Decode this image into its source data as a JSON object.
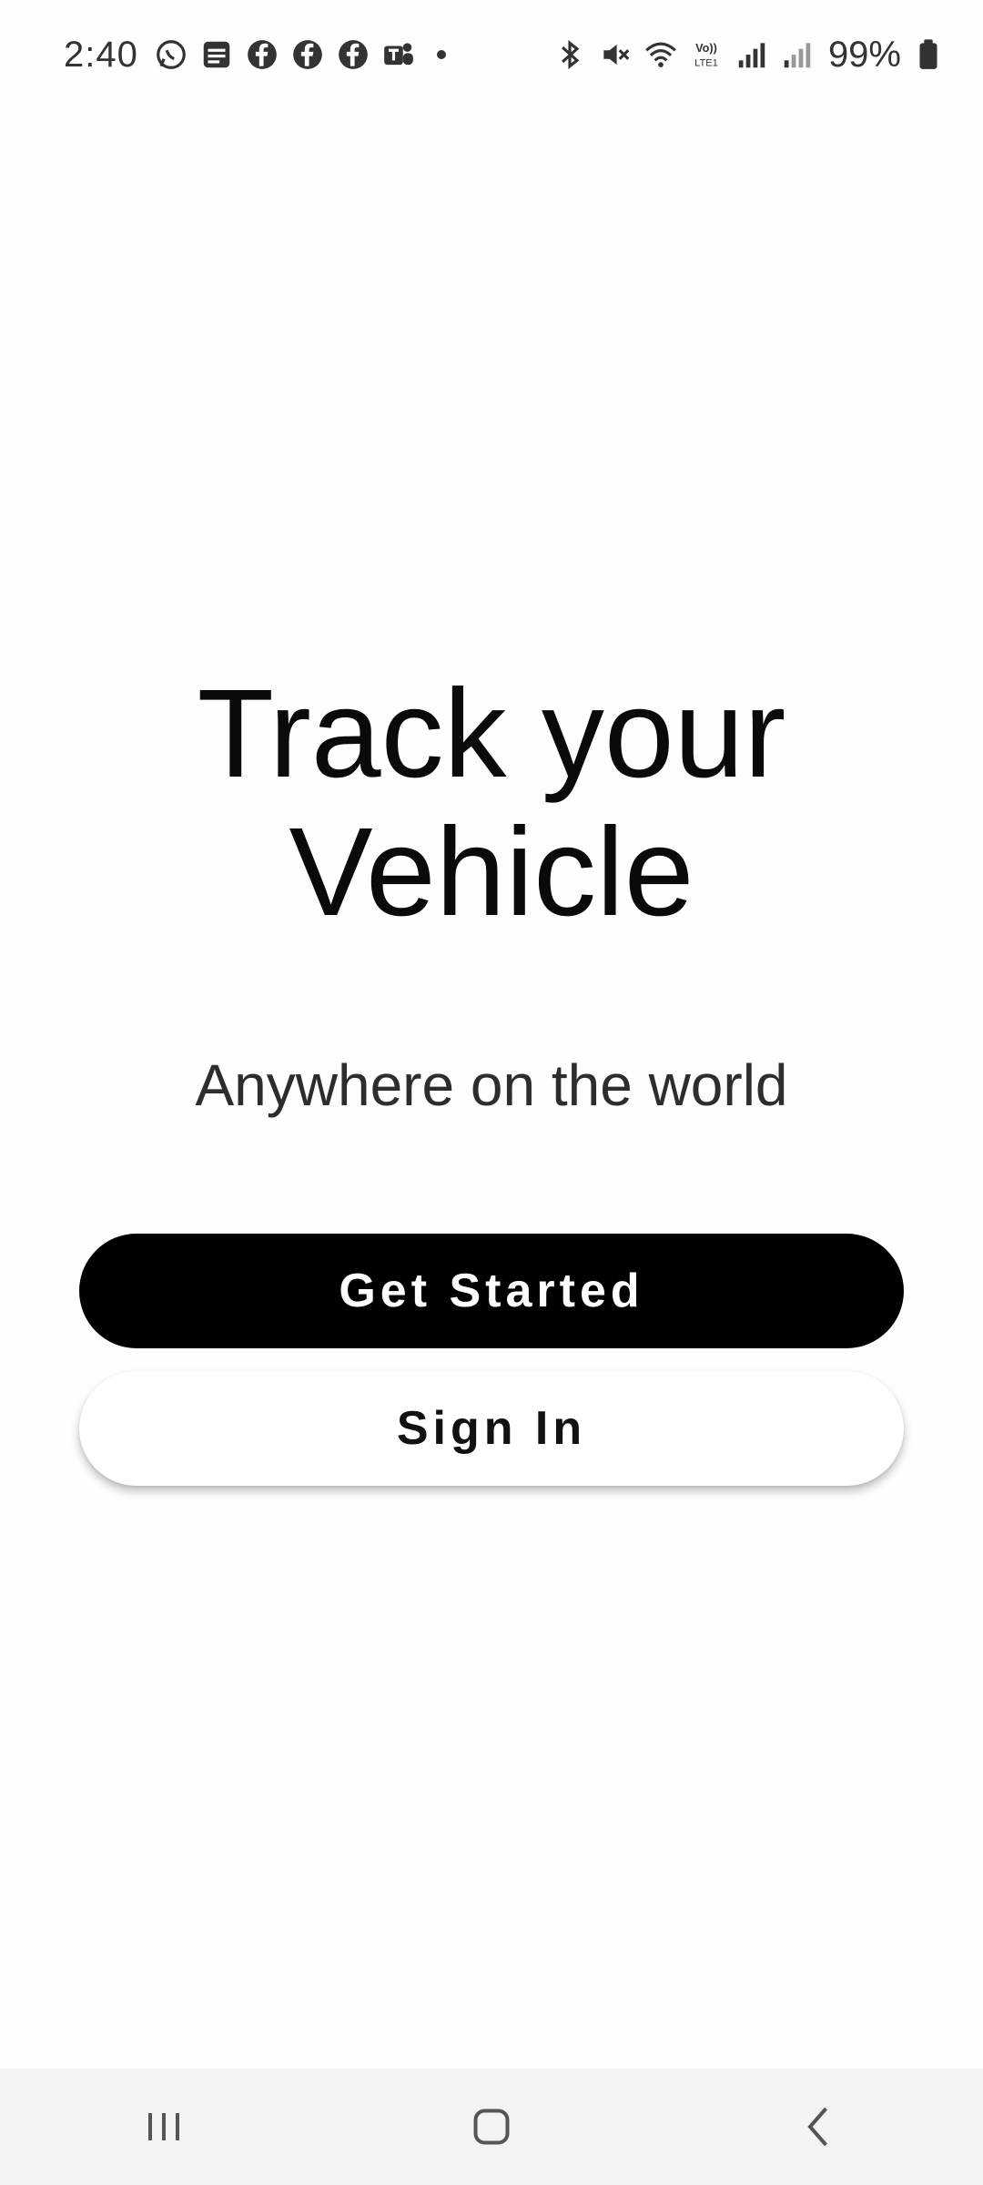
{
  "status_bar": {
    "time": "2:40",
    "left_icons": [
      "whatsapp-icon",
      "messages-icon",
      "facebook-icon",
      "facebook-icon",
      "facebook-icon",
      "teams-icon"
    ],
    "right_icons": [
      "bluetooth-icon",
      "mute-icon",
      "wifi-icon",
      "volte-icon",
      "signal-icon",
      "signal-icon"
    ],
    "volte_label": "Vo)) LTE1",
    "battery_percent": "99%"
  },
  "hero": {
    "title_line1": "Track your",
    "title_line2": "Vehicle",
    "subtitle": "Anywhere on the world"
  },
  "actions": {
    "get_started_label": "Get Started",
    "sign_in_label": "Sign In"
  },
  "colors": {
    "primary_button": "#000000",
    "secondary_button": "#ffffff",
    "background": "#fefefe",
    "nav_bar": "#f3f3f3"
  },
  "nav_bar": {
    "items": [
      "recent-apps-icon",
      "home-icon",
      "back-icon"
    ]
  }
}
